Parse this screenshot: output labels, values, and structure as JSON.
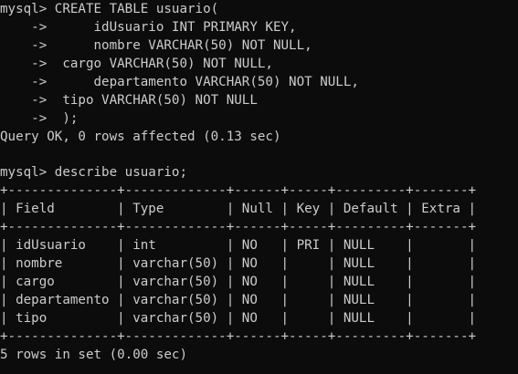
{
  "terminal": {
    "lines": [
      "mysql> CREATE TABLE usuario(",
      "    ->      idUsuario INT PRIMARY KEY,",
      "    ->      nombre VARCHAR(50) NOT NULL,",
      "    ->  cargo VARCHAR(50) NOT NULL,",
      "    ->      departamento VARCHAR(50) NOT NULL,",
      "    ->  tipo VARCHAR(50) NOT NULL",
      "    ->  );",
      "Query OK, 0 rows affected (0.13 sec)",
      "",
      "mysql> describe usuario;",
      "+--------------+-------------+------+-----+---------+-------+",
      "| Field        | Type        | Null | Key | Default | Extra |",
      "+--------------+-------------+------+-----+---------+-------+",
      "| idUsuario    | int         | NO   | PRI | NULL    |       |",
      "| nombre       | varchar(50) | NO   |     | NULL    |       |",
      "| cargo        | varchar(50) | NO   |     | NULL    |       |",
      "| departamento | varchar(50) | NO   |     | NULL    |       |",
      "| tipo         | varchar(50) | NO   |     | NULL    |       |",
      "+--------------+-------------+------+-----+---------+-------+",
      "5 rows in set (0.00 sec)"
    ],
    "colors": {
      "background": "#0c0c0c",
      "foreground": "#cccccc"
    }
  }
}
